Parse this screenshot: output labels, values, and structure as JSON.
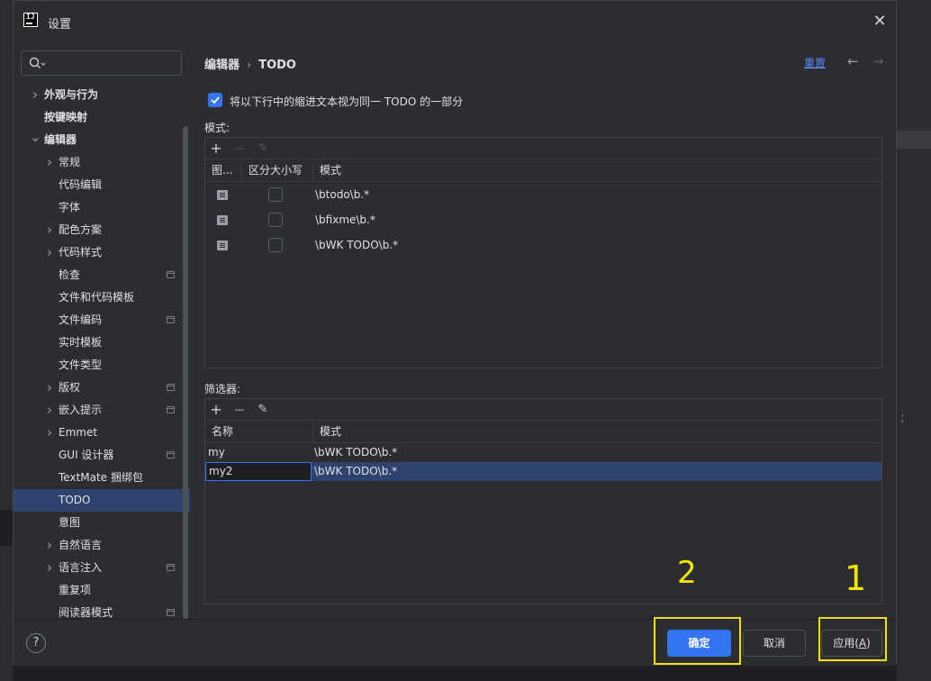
{
  "dialog": {
    "title": "设置",
    "close_icon": "close-icon",
    "app_icon_text": "IJ"
  },
  "search": {
    "placeholder": ""
  },
  "sidebar": {
    "items": [
      {
        "label": "外观与行为",
        "bold": true,
        "chevron": "right",
        "level": 0
      },
      {
        "label": "按键映射",
        "bold": true,
        "chevron": "",
        "level": 0
      },
      {
        "label": "编辑器",
        "bold": true,
        "chevron": "down",
        "level": 0
      },
      {
        "label": "常规",
        "chevron": "right",
        "level": 1
      },
      {
        "label": "代码编辑",
        "chevron": "",
        "level": 1
      },
      {
        "label": "字体",
        "chevron": "",
        "level": 1
      },
      {
        "label": "配色方案",
        "chevron": "right",
        "level": 1
      },
      {
        "label": "代码样式",
        "chevron": "right",
        "level": 1
      },
      {
        "label": "检查",
        "chevron": "",
        "level": 1,
        "project_icon": true
      },
      {
        "label": "文件和代码模板",
        "chevron": "",
        "level": 1
      },
      {
        "label": "文件编码",
        "chevron": "",
        "level": 1,
        "project_icon": true
      },
      {
        "label": "实时模板",
        "chevron": "",
        "level": 1
      },
      {
        "label": "文件类型",
        "chevron": "",
        "level": 1
      },
      {
        "label": "版权",
        "chevron": "right",
        "level": 1,
        "project_icon": true
      },
      {
        "label": "嵌入提示",
        "chevron": "right",
        "level": 1,
        "project_icon": true
      },
      {
        "label": "Emmet",
        "chevron": "right",
        "level": 1
      },
      {
        "label": "GUI 设计器",
        "chevron": "",
        "level": 1,
        "project_icon": true
      },
      {
        "label": "TextMate 捆绑包",
        "chevron": "",
        "level": 1
      },
      {
        "label": "TODO",
        "chevron": "",
        "level": 1,
        "selected": true
      },
      {
        "label": "意图",
        "chevron": "",
        "level": 1
      },
      {
        "label": "自然语言",
        "chevron": "right",
        "level": 1
      },
      {
        "label": "语言注入",
        "chevron": "right",
        "level": 1,
        "project_icon": true
      },
      {
        "label": "重复项",
        "chevron": "",
        "level": 1
      },
      {
        "label": "阅读器模式",
        "chevron": "",
        "level": 1,
        "project_icon": true
      }
    ]
  },
  "header": {
    "crumb_parent": "编辑器",
    "crumb_sep": "›",
    "crumb_current": "TODO",
    "reset": "重置",
    "back": "←",
    "forward": "→"
  },
  "option": {
    "checked": true,
    "label": "将以下行中的缩进文本视为同一 TODO 的一部分"
  },
  "patterns": {
    "label": "模式:",
    "toolbar": {
      "add": "+",
      "remove": "—",
      "edit": "✎"
    },
    "columns": [
      "图...",
      "区分大小写",
      "模式"
    ],
    "rows": [
      {
        "icon": "document-icon",
        "case_sensitive": false,
        "pattern": "\\btodo\\b.*"
      },
      {
        "icon": "document-icon",
        "case_sensitive": false,
        "pattern": "\\bfixme\\b.*"
      },
      {
        "icon": "document-icon",
        "case_sensitive": false,
        "pattern": "\\bWK TODO\\b.*"
      }
    ]
  },
  "filters": {
    "label": "筛选器:",
    "toolbar": {
      "add": "+",
      "remove": "—",
      "edit": "✎"
    },
    "columns": [
      "名称",
      "模式"
    ],
    "rows": [
      {
        "name": "my",
        "pattern": "\\bWK TODO\\b.*",
        "selected": false,
        "editing": false
      },
      {
        "name": "my2",
        "pattern": "\\bWK TODO\\b.*",
        "selected": true,
        "editing": true
      }
    ]
  },
  "footer": {
    "help": "?",
    "ok": "确定",
    "cancel": "取消",
    "apply_prefix": "应用(",
    "apply_mnemonic": "A",
    "apply_suffix": ")"
  },
  "annotations": {
    "mark_2": "2",
    "mark_1": "1",
    "color": "#f5e400"
  },
  "colors": {
    "accent": "#3574f0",
    "selection": "#2e436e",
    "link": "#548af7",
    "background": "#2b2d30"
  }
}
